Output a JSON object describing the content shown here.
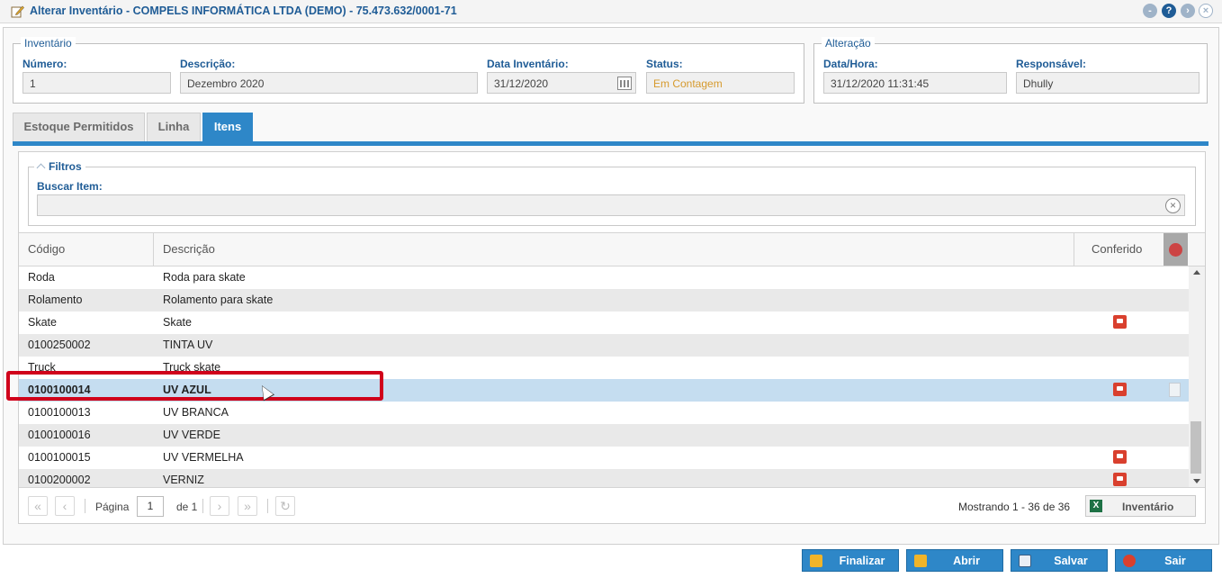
{
  "window": {
    "title": "Alterar Inventário - COMPELS INFORMÁTICA LTDA (DEMO) - 75.473.632/0001-71",
    "buttons": [
      "-",
      "?",
      "›",
      "×"
    ]
  },
  "inventario": {
    "legend": "Inventário",
    "numero_label": "Número:",
    "numero_value": "1",
    "descricao_label": "Descrição:",
    "descricao_value": "Dezembro 2020",
    "data_label": "Data Inventário:",
    "data_value": "31/12/2020",
    "status_label": "Status:",
    "status_value": "Em Contagem"
  },
  "alteracao": {
    "legend": "Alteração",
    "datahora_label": "Data/Hora:",
    "datahora_value": "31/12/2020 11:31:45",
    "responsavel_label": "Responsável:",
    "responsavel_value": "Dhully"
  },
  "tabs": [
    {
      "label": "Estoque Permitidos"
    },
    {
      "label": "Linha"
    },
    {
      "label": "Itens"
    }
  ],
  "filtros": {
    "legend": "Filtros",
    "buscar_label": "Buscar Item:",
    "buscar_value": ""
  },
  "grid": {
    "columns": [
      "Código",
      "Descrição",
      "Conferido"
    ],
    "rows": [
      {
        "codigo": "Roda",
        "descricao": "Roda para skate",
        "conferido": false
      },
      {
        "codigo": "Rolamento",
        "descricao": "Rolamento para skate",
        "conferido": false
      },
      {
        "codigo": "Skate",
        "descricao": "Skate",
        "conferido": true
      },
      {
        "codigo": "0100250002",
        "descricao": "TINTA UV",
        "conferido": false
      },
      {
        "codigo": "Truck",
        "descricao": "Truck skate",
        "conferido": false
      },
      {
        "codigo": "0100100014",
        "descricao": "UV AZUL",
        "conferido": true,
        "selected": true
      },
      {
        "codigo": "0100100013",
        "descricao": "UV BRANCA",
        "conferido": false
      },
      {
        "codigo": "0100100016",
        "descricao": "UV VERDE",
        "conferido": false
      },
      {
        "codigo": "0100100015",
        "descricao": "UV VERMELHA",
        "conferido": true
      },
      {
        "codigo": "0100200002",
        "descricao": "VERNIZ",
        "conferido": true
      }
    ]
  },
  "pager": {
    "pagina_label": "Página",
    "pagina_value": "1",
    "de_label": "de 1",
    "showing": "Mostrando 1 - 36 de 36",
    "export_label": "Inventário"
  },
  "footer": {
    "finalizar": "Finalizar",
    "abrir": "Abrir",
    "salvar": "Salvar",
    "sair": "Sair"
  },
  "colors": {
    "accent": "#2e87c8",
    "title": "#1f5c96",
    "status": "#d69a2d",
    "highlight": "#d0021b",
    "selected_row": "#c5ddf0"
  }
}
